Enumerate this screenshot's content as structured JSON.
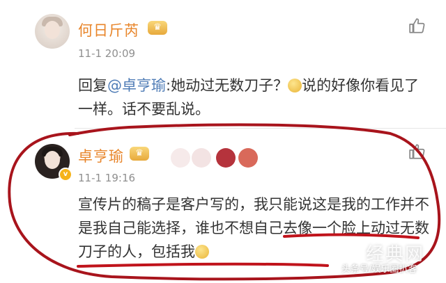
{
  "colors": {
    "username": "#e8852a",
    "mention": "#4f7cb6",
    "annotation": "#b3131b"
  },
  "comments": [
    {
      "username": "何日斤芮",
      "time": "11-1 20:09",
      "badge_icon": "crown-icon",
      "body": {
        "prefix": "回复",
        "mention": "@卓亨瑜",
        "text_before_emoji": ":她动过无数刀子？",
        "emoji": "laugh-emoji",
        "text_after_emoji": "说的好像你看见了一样。话不要乱说。"
      }
    },
    {
      "username": "卓亨瑜",
      "time": "11-1 19:16",
      "badge_icon": "crown-icon",
      "verified_icon": "verified-v-icon",
      "body": {
        "text": "宣传片的稿子是客户写的，我只能说这是我的工作并不是我自己能选择，谁也不想自己去像一个脸上动过无数刀子的人，包括我",
        "emoji": "laugh-emoji"
      }
    }
  ],
  "watermark": {
    "source": "头条号/娱乐圈扒客",
    "site": "经典网"
  }
}
